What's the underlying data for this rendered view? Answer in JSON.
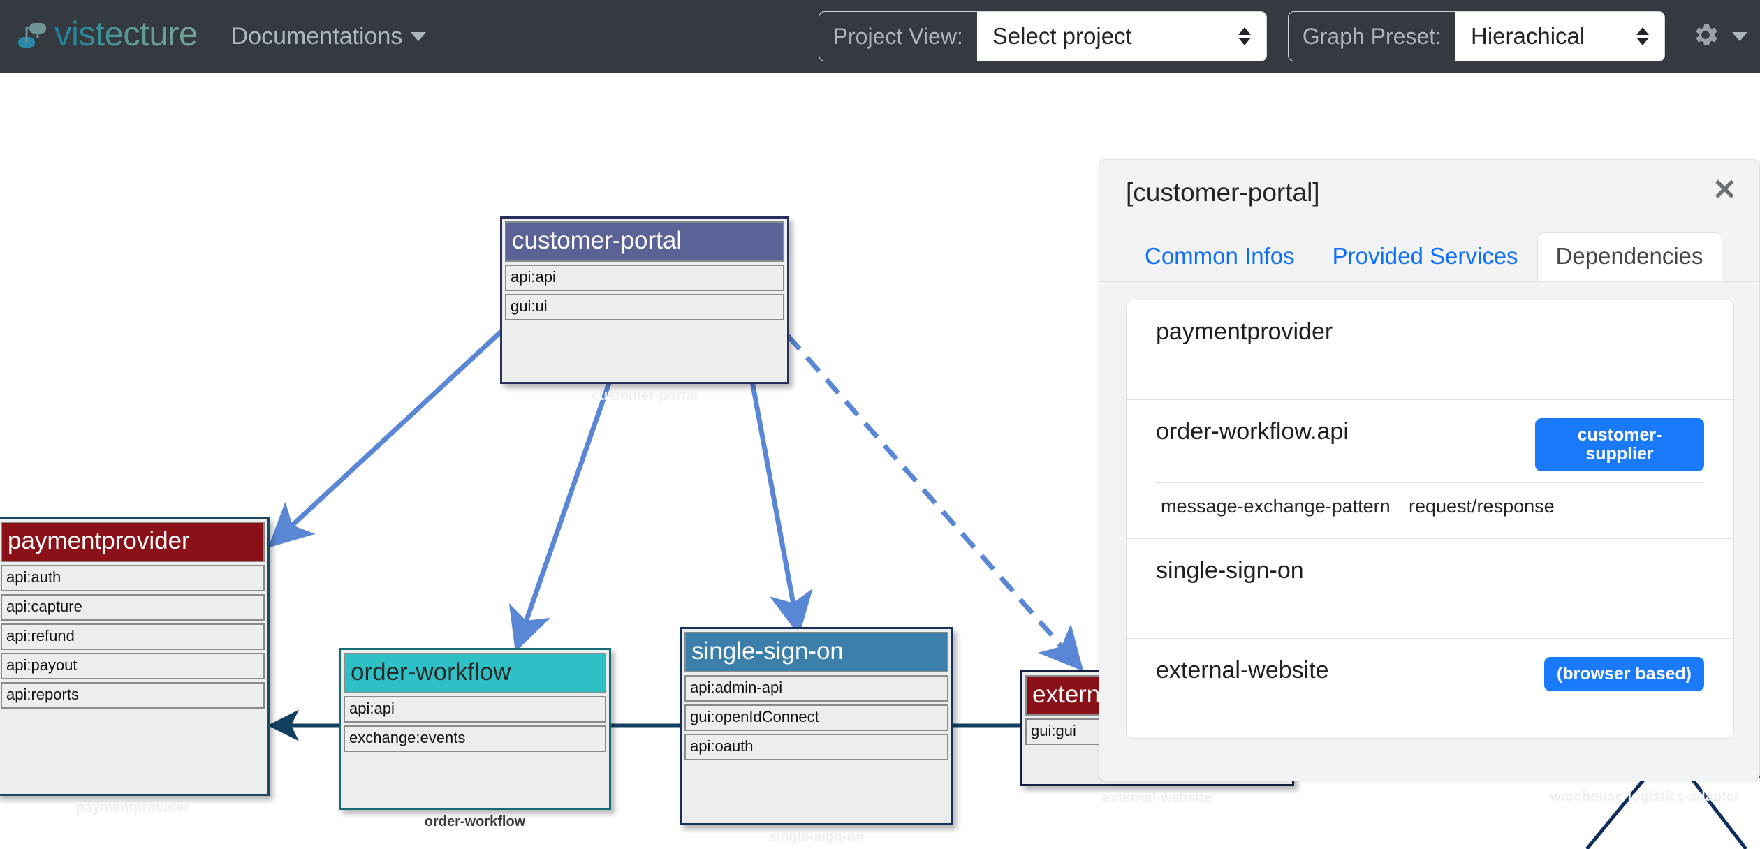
{
  "navbar": {
    "brand": "vistecture",
    "brand_icon": "sitemap-icon",
    "nav_items": [
      {
        "label": "Documentations",
        "icon": "caret-down-icon"
      }
    ],
    "project_view": {
      "label": "Project View:",
      "value": "Select project"
    },
    "graph_preset": {
      "label": "Graph Preset:",
      "value": "Hierachical"
    },
    "settings": {
      "icon": "gear-icon",
      "caret": "caret-down-icon"
    },
    "colors": {
      "bg": "#343a40",
      "label_text": "#aeb4ba",
      "brand_accent": "#1c7fa0"
    }
  },
  "diagram": {
    "nodes": [
      {
        "name": "customer-portal",
        "caption": "customer-portal",
        "title_bg": "#5b6296",
        "border": "#2b2f5e",
        "interfaces": [
          "api:api",
          "gui:ui"
        ]
      },
      {
        "name": "paymentprovider",
        "caption": "paymentprovider",
        "title_bg": "#8b1118",
        "border": "#1d4a63",
        "interfaces": [
          "api:auth",
          "api:capture",
          "api:refund",
          "api:payout",
          "api:reports"
        ]
      },
      {
        "name": "order-workflow",
        "caption": "order-workflow",
        "title_bg": "#2fc0c6",
        "border": "#176b72",
        "title_color": "#2a2a2a",
        "interfaces": [
          "api:api",
          "exchange:events"
        ]
      },
      {
        "name": "single-sign-on",
        "caption": "single-sign-on",
        "title_bg": "#3c7fab",
        "border": "#16325c",
        "interfaces": [
          "api:admin-api",
          "gui:openIdConnect",
          "api:oauth"
        ]
      },
      {
        "name": "external-website",
        "caption": "external-website",
        "title_bg": "#8b1118",
        "border": "#16213f",
        "interfaces": [
          "gui:gui"
        ]
      },
      {
        "name": "warehouse-logistics-adapter",
        "caption": "warehouse-logistics-adapter",
        "title_bg": "#16325c",
        "border": "#16325c",
        "interfaces": []
      }
    ],
    "edge_color_solid": "#5a86d6",
    "edge_color_dark": "#0d2d5e"
  },
  "panel": {
    "title": "[customer-portal]",
    "close_icon": "close-icon",
    "tabs": [
      {
        "label": "Common Infos",
        "active": false
      },
      {
        "label": "Provided Services",
        "active": false
      },
      {
        "label": "Dependencies",
        "active": true
      }
    ],
    "dependencies": [
      {
        "name": "paymentprovider",
        "badge": "",
        "rows": []
      },
      {
        "name": "order-workflow.api",
        "badge": "customer-supplier",
        "rows": [
          {
            "key": "message-exchange-pattern",
            "value": "request/response"
          }
        ]
      },
      {
        "name": "single-sign-on",
        "badge": "",
        "rows": []
      },
      {
        "name": "external-website",
        "badge": "(browser based)",
        "rows": []
      }
    ],
    "badge_color": "#1a7afc"
  }
}
